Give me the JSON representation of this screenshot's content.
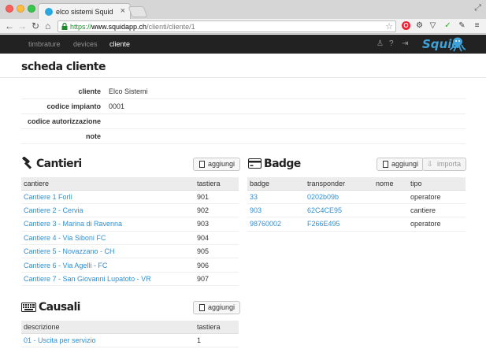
{
  "browser": {
    "tab_title": "elco sistemi Squid",
    "url_scheme": "https://",
    "url_host": "www.squidapp.ch",
    "url_path": "/clienti/cliente/1"
  },
  "navbar": {
    "links": [
      "timbrature",
      "devices",
      "cliente"
    ],
    "active": "cliente",
    "brand": "Squid"
  },
  "page": {
    "title": "scheda cliente"
  },
  "client_info": [
    {
      "label": "cliente",
      "value": "Elco Sistemi"
    },
    {
      "label": "codice impianto",
      "value": "0001"
    },
    {
      "label": "codice autorizzazione",
      "value": ""
    },
    {
      "label": "note",
      "value": ""
    }
  ],
  "cantieri": {
    "title": "Cantieri",
    "add_label": "aggiungi",
    "columns": [
      "cantiere",
      "tastiera"
    ],
    "rows": [
      [
        "Cantiere 1 Forlì",
        "901"
      ],
      [
        "Cantiere 2 - Cervia",
        "902"
      ],
      [
        "Cantiere 3 - Marina di Ravenna",
        "903"
      ],
      [
        "Cantiere 4 - Via Siboni FC",
        "904"
      ],
      [
        "Cantiere 5 - Novazzano - CH",
        "905"
      ],
      [
        "Cantiere 6 - Via Agelli - FC",
        "906"
      ],
      [
        "Cantiere 7 - San Giovanni Lupatoto - VR",
        "907"
      ]
    ]
  },
  "badge": {
    "title": "Badge",
    "add_label": "aggiungi",
    "import_label": "importa",
    "columns": [
      "badge",
      "transponder",
      "nome",
      "tipo"
    ],
    "rows": [
      [
        "33",
        "0202b09b",
        "",
        "operatore"
      ],
      [
        "903",
        "62C4CE95",
        "",
        "cantiere"
      ],
      [
        "98760002",
        "F266E495",
        "",
        "operatore"
      ]
    ]
  },
  "causali": {
    "title": "Causali",
    "add_label": "aggiungi",
    "columns": [
      "descrizione",
      "tastiera"
    ],
    "rows": [
      [
        "01 - Uscita per servizio",
        "1"
      ]
    ]
  },
  "colors": {
    "link": "#2f8fd3",
    "navbar": "#222222",
    "brand": "#3fa2d8"
  }
}
